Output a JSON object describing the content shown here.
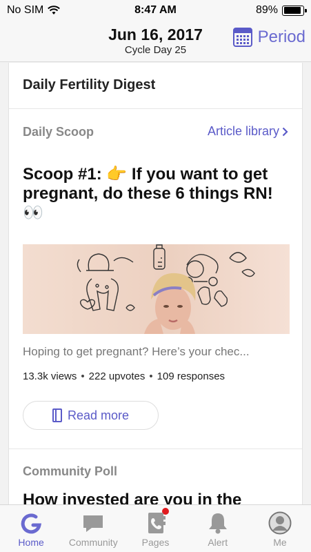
{
  "status_bar": {
    "carrier": "No SIM",
    "time": "8:47 AM",
    "battery": "89%",
    "battery_level": 0.89
  },
  "header": {
    "date": "Jun 16, 2017",
    "cycle": "Cycle Day 25",
    "period_label": "Period",
    "period_icon": "calendar-icon"
  },
  "card": {
    "title": "Daily Fertility Digest",
    "scoop_section": "Daily Scoop",
    "article_library": "Article library",
    "scoop_title": "Scoop #1: 👉  If you want to get pregnant, do these 6 things RN! 👀",
    "excerpt": "Hoping to get pregnant? Here’s your chec...",
    "stats": {
      "views": "13.3k views",
      "upvotes": "222 upvotes",
      "responses": "109 responses",
      "separator": "•"
    },
    "read_more": "Read more",
    "poll_section": "Community Poll",
    "poll_title": "How invested are you in the"
  },
  "tabs": [
    {
      "label": "Home",
      "icon": "glow-logo-icon",
      "active": true
    },
    {
      "label": "Community",
      "icon": "chat-bubble-icon",
      "active": false
    },
    {
      "label": "Pages",
      "icon": "phone-book-icon",
      "active": false
    },
    {
      "label": "Alert",
      "icon": "bell-icon",
      "active": false
    },
    {
      "label": "Me",
      "icon": "avatar-icon",
      "active": false
    }
  ],
  "colors": {
    "accent": "#5a5ac8",
    "badge": "#e0191e"
  }
}
